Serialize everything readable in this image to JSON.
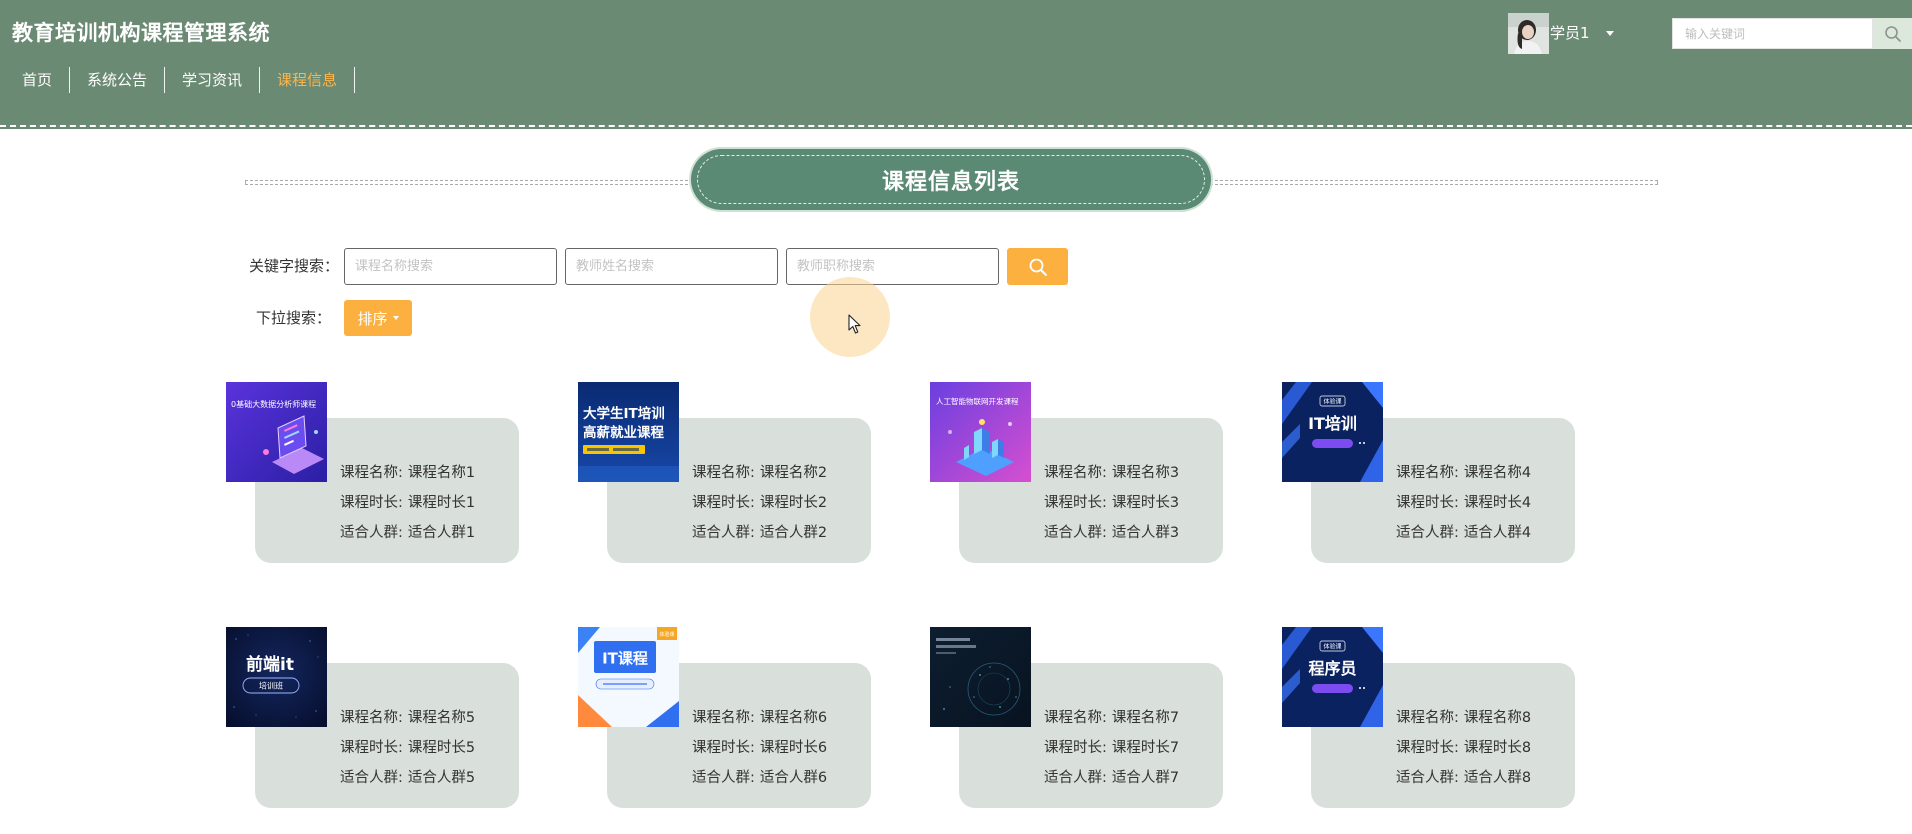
{
  "header": {
    "title": "教育培训机构课程管理系统",
    "nav": [
      {
        "label": "首页",
        "active": false
      },
      {
        "label": "系统公告",
        "active": false
      },
      {
        "label": "学习资讯",
        "active": false
      },
      {
        "label": "课程信息",
        "active": true
      }
    ],
    "user": {
      "name": "学员1",
      "avatar_icon": "user-photo"
    },
    "search": {
      "placeholder": "输入关键词",
      "icon": "search-icon"
    }
  },
  "section": {
    "title": "课程信息列表"
  },
  "filters": {
    "keyword_label": "关键字搜索：",
    "inputs": [
      {
        "placeholder": "课程名称搜索",
        "value": ""
      },
      {
        "placeholder": "教师姓名搜索",
        "value": ""
      },
      {
        "placeholder": "教师职称搜索",
        "value": ""
      }
    ],
    "search_icon": "search-icon",
    "dropdown_label": "下拉搜索：",
    "sort_label": "排序"
  },
  "course_labels": {
    "name": "课程名称:",
    "duration": "课程时长:",
    "audience": "适合人群:"
  },
  "courses": [
    {
      "name": "课程名称1",
      "duration": "课程时长1",
      "audience": "适合人群1",
      "thumb": {
        "lines": [
          "0基础大数据分析师课程"
        ]
      }
    },
    {
      "name": "课程名称2",
      "duration": "课程时长2",
      "audience": "适合人群2",
      "thumb": {
        "lines": [
          "大学生IT培训",
          "高薪就业课程"
        ]
      }
    },
    {
      "name": "课程名称3",
      "duration": "课程时长3",
      "audience": "适合人群3",
      "thumb": {
        "lines": [
          "人工智能物联网开发课程"
        ]
      }
    },
    {
      "name": "课程名称4",
      "duration": "课程时长4",
      "audience": "适合人群4",
      "thumb": {
        "badge": "体验课",
        "lines": [
          "IT培训"
        ]
      }
    },
    {
      "name": "课程名称5",
      "duration": "课程时长5",
      "audience": "适合人群5",
      "thumb": {
        "lines": [
          "前端it"
        ],
        "pill": "培训班"
      }
    },
    {
      "name": "课程名称6",
      "duration": "课程时长6",
      "audience": "适合人群6",
      "thumb": {
        "badge": "体验课",
        "lines": [
          "IT课程"
        ]
      }
    },
    {
      "name": "课程名称7",
      "duration": "课程时长7",
      "audience": "适合人群7"
    },
    {
      "name": "课程名称8",
      "duration": "课程时长8",
      "audience": "适合人群8",
      "thumb": {
        "badge": "体验课",
        "lines": [
          "程序员"
        ]
      }
    }
  ],
  "colors": {
    "header_bg": "#6b8a74",
    "accent": "#fbb040",
    "active_nav": "#ffb547",
    "title_pill": "#5a8a74",
    "card_panel": "#d9dfda"
  }
}
